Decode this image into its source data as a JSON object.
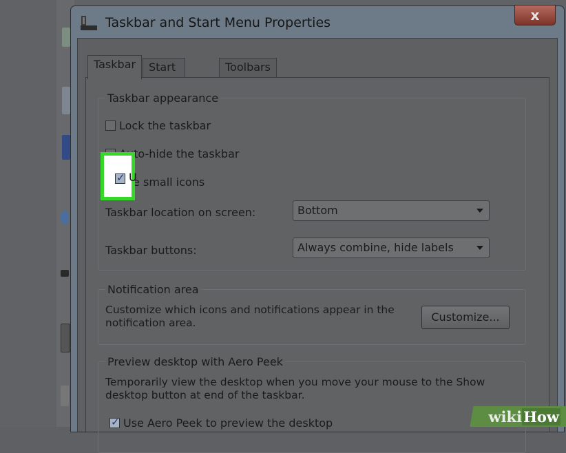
{
  "window": {
    "title": "Taskbar and Start Menu Properties",
    "close_glyph": "x"
  },
  "tabs": [
    {
      "label": "Taskbar",
      "active": true
    },
    {
      "label": "Start Menu",
      "active": false
    },
    {
      "label": "Toolbars",
      "active": false
    }
  ],
  "appearance": {
    "legend": "Taskbar appearance",
    "lock_label": "Lock the taskbar",
    "lock_checked": false,
    "autohide_label": "Auto-hide the taskbar",
    "autohide_visible": "uto-hide the taskbar",
    "autohide_checked": false,
    "small_icons_label": "Use small icons",
    "small_icons_visible_u": "U",
    "small_icons_visible_rest": "e small icons",
    "small_icons_checked": true,
    "location_label": "Taskbar location on screen:",
    "location_value": "Bottom",
    "buttons_label": "Taskbar buttons:",
    "buttons_value": "Always combine, hide labels"
  },
  "notification": {
    "legend": "Notification area",
    "description": "Customize which icons and notifications appear in the notification area.",
    "customize_button": "Customize..."
  },
  "peek": {
    "legend": "Preview desktop with Aero Peek",
    "description": "Temporarily view the desktop when you move your mouse to the Show desktop button at end of the taskbar.",
    "use_peek_label": "Use Aero Peek to preview the desktop",
    "use_peek_checked": true
  },
  "watermark": {
    "part1": "wiki",
    "part2": "How"
  },
  "colors": {
    "highlight": "#36d62a",
    "close_button": "#9b4a3e"
  },
  "icons": [
    "window-app-icon",
    "close-icon",
    "checkbox-check-icon",
    "dropdown-caret-icon"
  ]
}
